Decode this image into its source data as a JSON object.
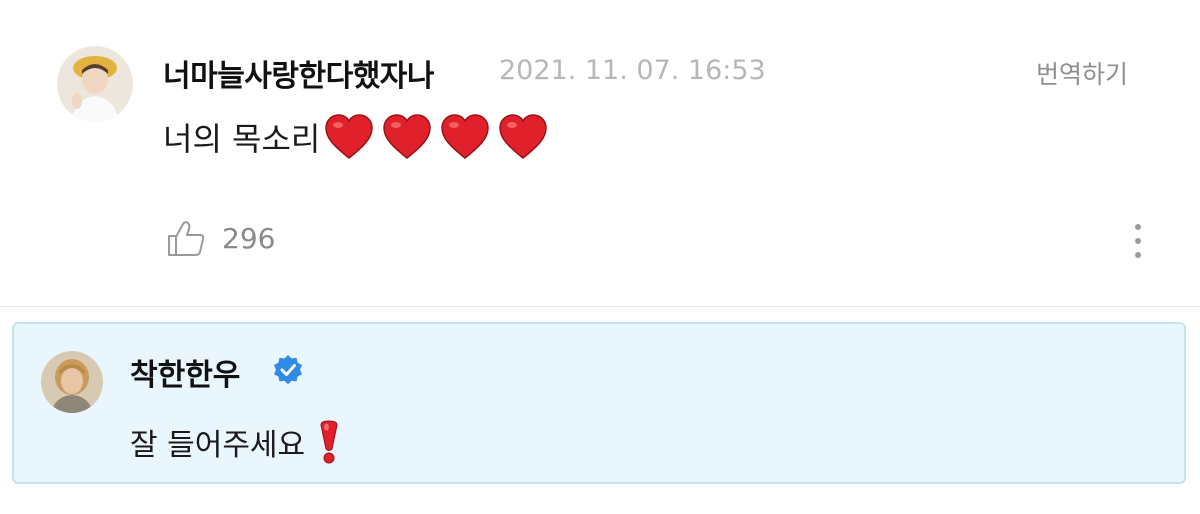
{
  "comment": {
    "username": "너마늘사랑한다했자나",
    "timestamp": "2021. 11. 07. 16:53",
    "translate_label": "번역하기",
    "text": "너의 목소리",
    "emoji": [
      "heart",
      "heart",
      "heart",
      "heart"
    ],
    "like_count": "296"
  },
  "reply": {
    "username": "착한한우",
    "verified": true,
    "text": "잘 들어주세요",
    "emoji": "heavy-exclamation-mark"
  },
  "colors": {
    "reply_background": "#eaf6fd",
    "reply_border": "#c6e2f2",
    "verified_badge": "#2f8ae8",
    "timestamp": "#b7b7b7",
    "heart": "#e0202a"
  },
  "icons": {
    "like": "thumbs-up-icon",
    "more": "vertical-dots-icon",
    "verified": "verified-badge-icon"
  }
}
